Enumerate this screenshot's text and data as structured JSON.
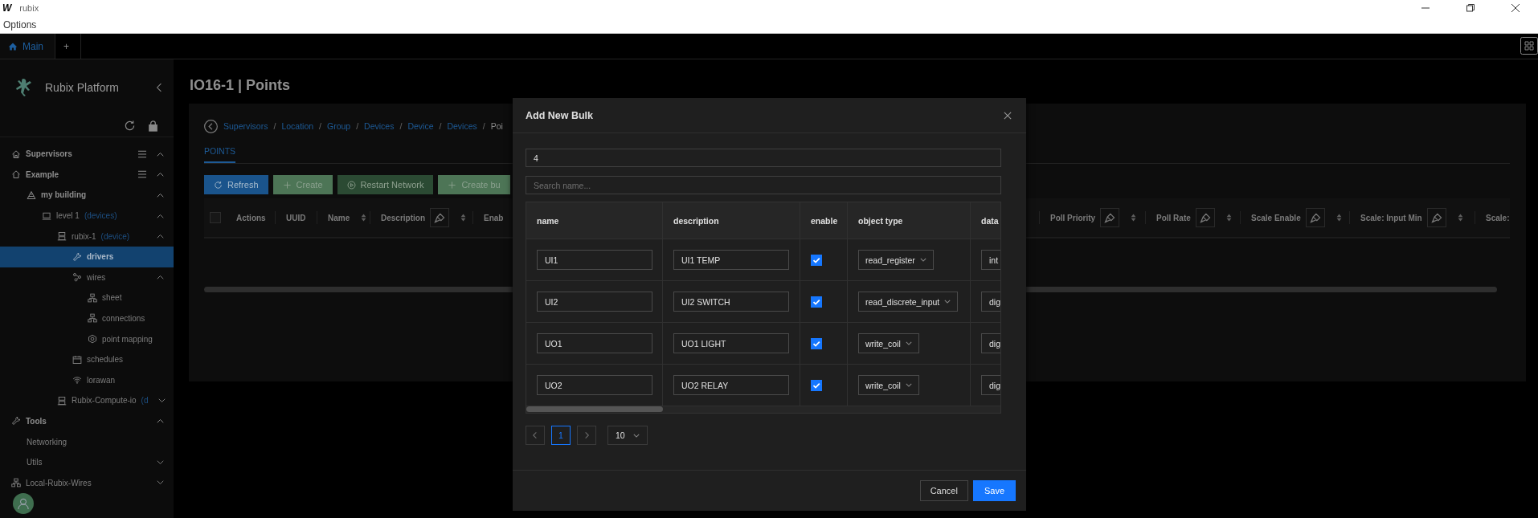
{
  "window": {
    "logo": "W",
    "title": "rubix",
    "menu": [
      "Options"
    ]
  },
  "tabs": [
    {
      "label": "Main",
      "selected": true
    },
    {
      "label": "+",
      "selected": false
    }
  ],
  "sidebar": {
    "brand": "Rubix Platform",
    "items": [
      {
        "label": "Supervisors",
        "kind": "supervisors",
        "menu": true,
        "expanded": true,
        "selected": false
      },
      {
        "label": "Example",
        "kind": "site",
        "menu": true,
        "expanded": true,
        "selected": false,
        "children": [
          {
            "label": "my building",
            "kind": "building",
            "expanded": true,
            "selected": false,
            "children": [
              {
                "label": "level 1",
                "tag": "(devices)",
                "kind": "floor",
                "expanded": true,
                "selected": false,
                "children": [
                  {
                    "label": "rubix-1",
                    "tag": "(device)",
                    "kind": "device",
                    "expanded": true,
                    "selected": false,
                    "children": [
                      {
                        "label": "drivers",
                        "kind": "drivers",
                        "selected": true
                      },
                      {
                        "label": "wires",
                        "kind": "wires",
                        "expanded": true,
                        "selected": false,
                        "children": [
                          {
                            "label": "sheet",
                            "kind": "sheet",
                            "selected": false
                          },
                          {
                            "label": "connections",
                            "kind": "sheet",
                            "selected": false
                          },
                          {
                            "label": "point mapping",
                            "kind": "mapping",
                            "selected": false
                          }
                        ]
                      },
                      {
                        "label": "schedules",
                        "kind": "schedules",
                        "selected": false
                      },
                      {
                        "label": "lorawan",
                        "kind": "lorawan",
                        "selected": false
                      }
                    ]
                  },
                  {
                    "label": "Rubix-Compute-io",
                    "tag": "(d",
                    "kind": "device",
                    "expanded": false,
                    "selected": false
                  }
                ]
              }
            ]
          }
        ]
      },
      {
        "label": "Tools",
        "kind": "tools",
        "expanded": true,
        "selected": false,
        "children": [
          {
            "label": "Networking",
            "kind": "page",
            "selected": false
          },
          {
            "label": "Utils",
            "kind": "page",
            "expanded": false,
            "selected": false
          }
        ]
      },
      {
        "label": "Local-Rubix-Wires",
        "kind": "network",
        "expanded": false,
        "selected": false
      }
    ]
  },
  "page": {
    "title": "IO16-1 | Points",
    "breadcrumb": [
      "Supervisors",
      "Location",
      "Group",
      "Devices",
      "Device",
      "Devices",
      "Poi"
    ],
    "breadcrumb_separator": "/",
    "tabs": [
      {
        "label": "POINTS",
        "selected": true
      }
    ],
    "buttons": [
      {
        "label": "Refresh",
        "kind": "primary"
      },
      {
        "label": "Create",
        "kind": "success"
      },
      {
        "label": "Restart Network",
        "kind": "dark"
      },
      {
        "label": "Create bu",
        "kind": "success"
      }
    ],
    "select_all": false,
    "columns_left": [
      {
        "label": "Actions"
      },
      {
        "label": "UUID"
      },
      {
        "label": "Name",
        "sort": true
      },
      {
        "label": "Description",
        "sort": true,
        "filter": true
      },
      {
        "label": "Enab"
      }
    ],
    "columns_right": [
      {
        "label": "Poll Priority",
        "sort": true,
        "filter": true
      },
      {
        "label": "Poll Rate",
        "sort": true,
        "filter": true
      },
      {
        "label": "Scale Enable",
        "sort": true,
        "filter": true
      },
      {
        "label": "Scale: Input Min",
        "sort": true,
        "filter": true
      },
      {
        "label": "Scale:"
      }
    ]
  },
  "dialog": {
    "title": "Add New Bulk",
    "count": "4",
    "search_placeholder": "Search name...",
    "columns": [
      "name",
      "description",
      "enable",
      "object type",
      "data"
    ],
    "rows": [
      {
        "name": "UI1",
        "description": "UI1 TEMP",
        "enable": true,
        "object_type": "read_register",
        "data": "int"
      },
      {
        "name": "UI2",
        "description": "UI2 SWITCH",
        "enable": true,
        "object_type": "read_discrete_input",
        "data": "dig"
      },
      {
        "name": "UO1",
        "description": "UO1 LIGHT",
        "enable": true,
        "object_type": "write_coil",
        "data": "dig"
      },
      {
        "name": "UO2",
        "description": "UO2 RELAY",
        "enable": true,
        "object_type": "write_coil",
        "data": "dig"
      }
    ],
    "page": "1",
    "page_size": "10",
    "buttons": [
      {
        "label": "Cancel",
        "kind": "default"
      },
      {
        "label": "Save",
        "kind": "primary"
      }
    ]
  }
}
